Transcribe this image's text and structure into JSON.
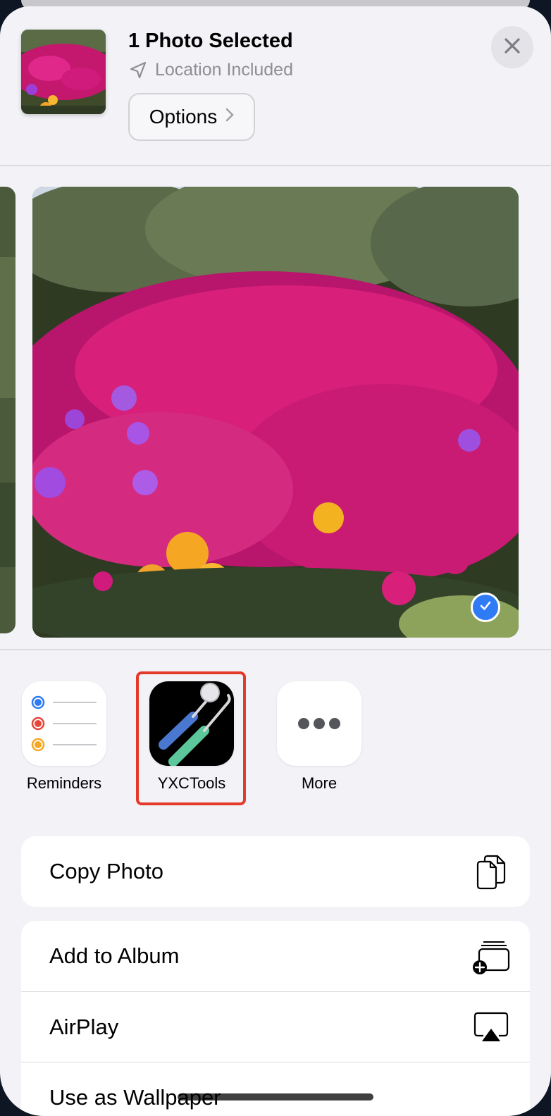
{
  "header": {
    "title": "1 Photo Selected",
    "location": "Location Included",
    "options_label": "Options"
  },
  "share_apps": [
    {
      "label": "Reminders"
    },
    {
      "label": "YXCTools"
    },
    {
      "label": "More"
    }
  ],
  "actions": {
    "copy_photo": "Copy Photo",
    "add_to_album": "Add to Album",
    "airplay": "AirPlay",
    "use_as_wallpaper": "Use as Wallpaper"
  },
  "colors": {
    "accent_blue": "#2f7bf5",
    "highlight_red": "#e33a2a",
    "flower_magenta": "#d81f7a"
  }
}
